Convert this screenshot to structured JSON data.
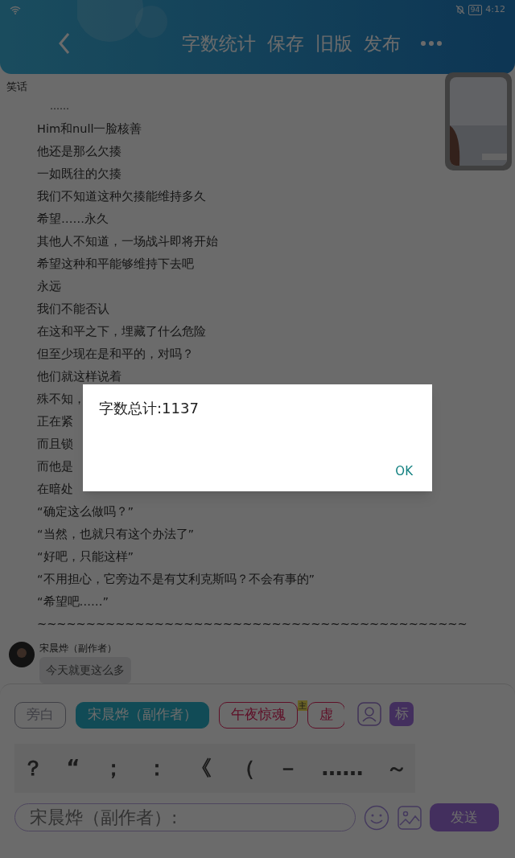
{
  "status_bar": {
    "battery": "94",
    "time": "4:12"
  },
  "header": {
    "actions": [
      "字数统计",
      "保存",
      "旧版",
      "发布"
    ]
  },
  "document": {
    "title": "笑话",
    "lines": [
      "……",
      "Him和null一脸核善",
      "他还是那么欠揍",
      "一如既往的欠揍",
      "我们不知道这种欠揍能维持多久",
      "希望……永久",
      "其他人不知道，一场战斗即将开始",
      "希望这种和平能够维持下去吧",
      "永远",
      "我们不能否认",
      "在这和平之下，埋藏了什么危险",
      "但至少现在是和平的，对吗？",
      "他们就这样说着",
      "殊不知，",
      "正在紧",
      "而且锁",
      "而他是",
      "在暗处",
      "“确定这么做吗？”",
      "“当然，也就只有这个办法了”",
      "“好吧，只能这样”",
      "“不用担心，它旁边不是有艾利克斯吗？不会有事的”",
      "“希望吧……”",
      "~~~~~~~~~~~~~~~~~~~~~~~~~~~~~~~~~~~~~~~~~~~~"
    ]
  },
  "comment": {
    "author": "宋晨烨（副作者）",
    "text": "今天就更这么多"
  },
  "roles": [
    {
      "label": "旁白",
      "selected": false,
      "kind": "narrator"
    },
    {
      "label": "宋晨烨（副作者）",
      "selected": true,
      "kind": "author"
    },
    {
      "label": "午夜惊魂",
      "selected": false,
      "kind": "character",
      "badge": "主"
    },
    {
      "label": "虚",
      "selected": false,
      "kind": "character"
    }
  ],
  "mark_button": "标",
  "punctuation": [
    "？",
    "“",
    "；",
    "：",
    "《",
    "（",
    "－",
    "……",
    "～"
  ],
  "input": {
    "placeholder": "宋晨烨（副作者）:"
  },
  "send_button": "发送",
  "dialog": {
    "message": "字数总计:1137",
    "button": "OK"
  }
}
